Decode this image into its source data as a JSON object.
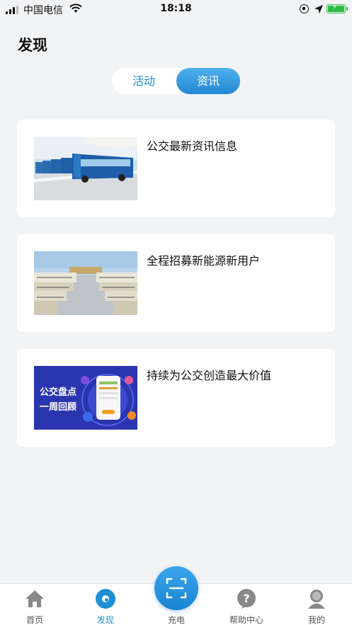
{
  "status_bar": {
    "carrier": "中国电信",
    "time": "18:18"
  },
  "page": {
    "title": "发现"
  },
  "segmented": {
    "tabs": [
      {
        "label": "活动",
        "selected": false
      },
      {
        "label": "资讯",
        "selected": true
      }
    ]
  },
  "news": [
    {
      "title": "公交最新资讯信息",
      "thumb_icon": "bus-depot-photo"
    },
    {
      "title": "全程招募新能源新用户",
      "thumb_icon": "bus-fleet-photo"
    },
    {
      "title": "持续为公交创造最大价值",
      "thumb_icon": "phone-promo-graphic",
      "thumb_text": [
        "公交盘点",
        "一周回顾"
      ]
    }
  ],
  "tabbar": {
    "items": [
      {
        "label": "首页",
        "icon": "home-icon",
        "active": false
      },
      {
        "label": "发现",
        "icon": "discover-icon",
        "active": true
      },
      {
        "label": "充电",
        "icon": "scan-icon",
        "active": false
      },
      {
        "label": "帮助中心",
        "icon": "help-icon",
        "active": false
      },
      {
        "label": "我的",
        "icon": "profile-icon",
        "active": false
      }
    ]
  },
  "colors": {
    "accent": "#1e8fd6",
    "background": "#f2f3f5",
    "battery": "#2dba44"
  }
}
